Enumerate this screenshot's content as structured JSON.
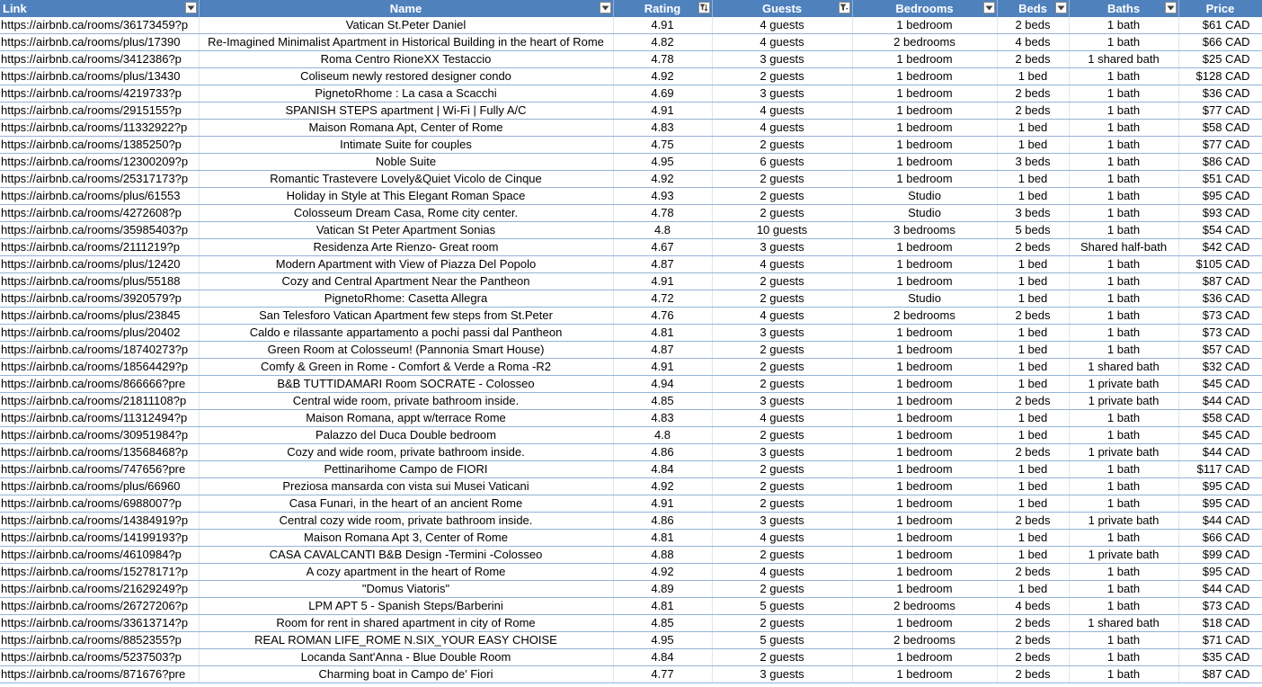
{
  "columns": [
    {
      "label": "Link",
      "filter": "dropdown"
    },
    {
      "label": "Name",
      "filter": "dropdown"
    },
    {
      "label": "Rating",
      "filter": "sorted-filtered"
    },
    {
      "label": "Guests",
      "filter": "filtered"
    },
    {
      "label": "Bedrooms",
      "filter": "dropdown"
    },
    {
      "label": "Beds",
      "filter": "dropdown"
    },
    {
      "label": "Baths",
      "filter": "dropdown"
    },
    {
      "label": "Price",
      "filter": "none"
    }
  ],
  "colors": {
    "header_bg": "#4f81bd",
    "row_border": "#95b3d7"
  },
  "rows": [
    [
      "https://airbnb.ca/rooms/36173459?p",
      "Vatican St.Peter Daniel",
      "4.91",
      "4 guests",
      "1 bedroom",
      "2 beds",
      "1 bath",
      "$61 CAD"
    ],
    [
      "https://airbnb.ca/rooms/plus/17390",
      "Re-Imagined Minimalist Apartment in Historical Building in the heart of Rome",
      "4.82",
      "4 guests",
      "2 bedrooms",
      "4 beds",
      "1 bath",
      "$66 CAD"
    ],
    [
      "https://airbnb.ca/rooms/3412386?p",
      "Roma Centro RioneXX Testaccio",
      "4.78",
      "3 guests",
      "1 bedroom",
      "2 beds",
      "1 shared bath",
      "$25 CAD"
    ],
    [
      "https://airbnb.ca/rooms/plus/13430",
      "Coliseum newly restored designer condo",
      "4.92",
      "2 guests",
      "1 bedroom",
      "1 bed",
      "1 bath",
      "$128 CAD"
    ],
    [
      "https://airbnb.ca/rooms/4219733?p",
      "PignetoRhome : La casa a Scacchi",
      "4.69",
      "3 guests",
      "1 bedroom",
      "2 beds",
      "1 bath",
      "$36 CAD"
    ],
    [
      "https://airbnb.ca/rooms/2915155?p",
      "SPANISH STEPS apartment | Wi-Fi | Fully A/C",
      "4.91",
      "4 guests",
      "1 bedroom",
      "2 beds",
      "1 bath",
      "$77 CAD"
    ],
    [
      "https://airbnb.ca/rooms/11332922?p",
      "Maison Romana Apt, Center of Rome",
      "4.83",
      "4 guests",
      "1 bedroom",
      "1 bed",
      "1 bath",
      "$58 CAD"
    ],
    [
      "https://airbnb.ca/rooms/1385250?p",
      "Intimate Suite for couples",
      "4.75",
      "2 guests",
      "1 bedroom",
      "1 bed",
      "1 bath",
      "$77 CAD"
    ],
    [
      "https://airbnb.ca/rooms/12300209?p",
      "Noble Suite",
      "4.95",
      "6 guests",
      "1 bedroom",
      "3 beds",
      "1 bath",
      "$86 CAD"
    ],
    [
      "https://airbnb.ca/rooms/25317173?p",
      "Romantic Trastevere Lovely&Quiet Vicolo de Cinque",
      "4.92",
      "2 guests",
      "1 bedroom",
      "1 bed",
      "1 bath",
      "$51 CAD"
    ],
    [
      "https://airbnb.ca/rooms/plus/61553",
      "Holiday in Style at This Elegant Roman Space",
      "4.93",
      "2 guests",
      "Studio",
      "1 bed",
      "1 bath",
      "$95 CAD"
    ],
    [
      "https://airbnb.ca/rooms/4272608?p",
      "Colosseum Dream Casa, Rome city center.",
      "4.78",
      "2 guests",
      "Studio",
      "3 beds",
      "1 bath",
      "$93 CAD"
    ],
    [
      "https://airbnb.ca/rooms/35985403?p",
      "Vatican St Peter Apartment Sonias",
      "4.8",
      "10 guests",
      "3 bedrooms",
      "5 beds",
      "1 bath",
      "$54 CAD"
    ],
    [
      "https://airbnb.ca/rooms/2111219?p",
      "Residenza Arte Rienzo- Great room",
      "4.67",
      "3 guests",
      "1 bedroom",
      "2 beds",
      "Shared half-bath",
      "$42 CAD"
    ],
    [
      "https://airbnb.ca/rooms/plus/12420",
      "Modern Apartment with View of Piazza Del Popolo",
      "4.87",
      "4 guests",
      "1 bedroom",
      "1 bed",
      "1 bath",
      "$105 CAD"
    ],
    [
      "https://airbnb.ca/rooms/plus/55188",
      "Cozy and Central Apartment Near the Pantheon",
      "4.91",
      "2 guests",
      "1 bedroom",
      "1 bed",
      "1 bath",
      "$87 CAD"
    ],
    [
      "https://airbnb.ca/rooms/3920579?p",
      "PignetoRhome: Casetta Allegra",
      "4.72",
      "2 guests",
      "Studio",
      "1 bed",
      "1 bath",
      "$36 CAD"
    ],
    [
      "https://airbnb.ca/rooms/plus/23845",
      "San Telesforo Vatican Apartment few steps from St.Peter",
      "4.76",
      "4 guests",
      "2 bedrooms",
      "2 beds",
      "1 bath",
      "$73 CAD"
    ],
    [
      "https://airbnb.ca/rooms/plus/20402",
      "Caldo e rilassante appartamento a pochi passi dal Pantheon",
      "4.81",
      "3 guests",
      "1 bedroom",
      "1 bed",
      "1 bath",
      "$73 CAD"
    ],
    [
      "https://airbnb.ca/rooms/18740273?p",
      "Green Room at Colosseum! (Pannonia Smart House)",
      "4.87",
      "2 guests",
      "1 bedroom",
      "1 bed",
      "1 bath",
      "$57 CAD"
    ],
    [
      "https://airbnb.ca/rooms/18564429?p",
      "Comfy & Green in Rome - Comfort & Verde a Roma -R2",
      "4.91",
      "2 guests",
      "1 bedroom",
      "1 bed",
      "1 shared bath",
      "$32 CAD"
    ],
    [
      "https://airbnb.ca/rooms/866666?pre",
      "B&B TUTTIDAMARI Room SOCRATE - Colosseo",
      "4.94",
      "2 guests",
      "1 bedroom",
      "1 bed",
      "1 private bath",
      "$45 CAD"
    ],
    [
      "https://airbnb.ca/rooms/21811108?p",
      "Central wide room, private bathroom inside.",
      "4.85",
      "3 guests",
      "1 bedroom",
      "2 beds",
      "1 private bath",
      "$44 CAD"
    ],
    [
      "https://airbnb.ca/rooms/11312494?p",
      "Maison Romana, appt w/terrace Rome",
      "4.83",
      "4 guests",
      "1 bedroom",
      "1 bed",
      "1 bath",
      "$58 CAD"
    ],
    [
      "https://airbnb.ca/rooms/30951984?p",
      "Palazzo del Duca Double bedroom",
      "4.8",
      "2 guests",
      "1 bedroom",
      "1 bed",
      "1 bath",
      "$45 CAD"
    ],
    [
      "https://airbnb.ca/rooms/13568468?p",
      "Cozy and wide room, private bathroom inside.",
      "4.86",
      "3 guests",
      "1 bedroom",
      "2 beds",
      "1 private bath",
      "$44 CAD"
    ],
    [
      "https://airbnb.ca/rooms/747656?pre",
      "Pettinarihome Campo de FIORI",
      "4.84",
      "2 guests",
      "1 bedroom",
      "1 bed",
      "1 bath",
      "$117 CAD"
    ],
    [
      "https://airbnb.ca/rooms/plus/66960",
      "Preziosa mansarda con vista sui Musei Vaticani",
      "4.92",
      "2 guests",
      "1 bedroom",
      "1 bed",
      "1 bath",
      "$95 CAD"
    ],
    [
      "https://airbnb.ca/rooms/6988007?p",
      "Casa Funari, in the heart of an ancient Rome",
      "4.91",
      "2 guests",
      "1 bedroom",
      "1 bed",
      "1 bath",
      "$95 CAD"
    ],
    [
      "https://airbnb.ca/rooms/14384919?p",
      "Central cozy wide room, private bathroom inside.",
      "4.86",
      "3 guests",
      "1 bedroom",
      "2 beds",
      "1 private bath",
      "$44 CAD"
    ],
    [
      "https://airbnb.ca/rooms/14199193?p",
      "Maison Romana Apt 3, Center of Rome",
      "4.81",
      "4 guests",
      "1 bedroom",
      "1 bed",
      "1 bath",
      "$66 CAD"
    ],
    [
      "https://airbnb.ca/rooms/4610984?p",
      "CASA CAVALCANTI B&B  Design -Termini -Colosseo",
      "4.88",
      "2 guests",
      "1 bedroom",
      "1 bed",
      "1 private bath",
      "$99 CAD"
    ],
    [
      "https://airbnb.ca/rooms/15278171?p",
      "A cozy apartment in the heart of Rome",
      "4.92",
      "4 guests",
      "1 bedroom",
      "2 beds",
      "1 bath",
      "$95 CAD"
    ],
    [
      "https://airbnb.ca/rooms/21629249?p",
      "\"Domus Viatoris\"",
      "4.89",
      "2 guests",
      "1 bedroom",
      "1 bed",
      "1 bath",
      "$44 CAD"
    ],
    [
      "https://airbnb.ca/rooms/26727206?p",
      "LPM APT 5 - Spanish Steps/Barberini",
      "4.81",
      "5 guests",
      "2 bedrooms",
      "4 beds",
      "1 bath",
      "$73 CAD"
    ],
    [
      "https://airbnb.ca/rooms/33613714?p",
      "Room for rent in shared apartment in city of Rome",
      "4.85",
      "2 guests",
      "1 bedroom",
      "2 beds",
      "1 shared bath",
      "$18 CAD"
    ],
    [
      "https://airbnb.ca/rooms/8852355?p",
      "REAL ROMAN LIFE_ROME N.SIX_YOUR EASY CHOISE",
      "4.95",
      "5 guests",
      "2 bedrooms",
      "2 beds",
      "1 bath",
      "$71 CAD"
    ],
    [
      "https://airbnb.ca/rooms/5237503?p",
      "Locanda Sant'Anna - Blue Double Room",
      "4.84",
      "2 guests",
      "1 bedroom",
      "2 beds",
      "1 bath",
      "$35 CAD"
    ],
    [
      "https://airbnb.ca/rooms/871676?pre",
      "Charming boat in Campo de' Fiori",
      "4.77",
      "3 guests",
      "1 bedroom",
      "2 beds",
      "1 bath",
      "$87 CAD"
    ]
  ]
}
